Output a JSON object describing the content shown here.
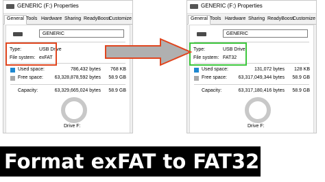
{
  "left_window": {
    "title": "GENERIC (F:) Properties",
    "tabs": [
      "General",
      "Tools",
      "Hardware",
      "Sharing",
      "ReadyBoost",
      "Customize"
    ],
    "volume_name": "GENERIC",
    "type_label": "Type:",
    "type_value": "USB Drive",
    "fs_label": "File system:",
    "fs_value": "exFAT",
    "used_label": "Used space:",
    "used_bytes": "786,432 bytes",
    "used_size": "768 KB",
    "free_label": "Free space:",
    "free_bytes": "63,328,878,592 bytes",
    "free_size": "58.9 GB",
    "capacity_label": "Capacity:",
    "capacity_bytes": "63,329,665,024 bytes",
    "capacity_size": "58.9 GB",
    "drive_label": "Drive F:",
    "highlight_color": "#e0451e"
  },
  "right_window": {
    "title": "GENERIC (F:) Properties",
    "tabs": [
      "General",
      "Tools",
      "Hardware",
      "Sharing",
      "ReadyBoost",
      "Customize"
    ],
    "volume_name": "GENERIC",
    "type_label": "Type:",
    "type_value": "USB Drive",
    "fs_label": "File system:",
    "fs_value": "FAT32",
    "used_label": "Used space:",
    "used_bytes": "131,072 bytes",
    "used_size": "128 KB",
    "free_label": "Free space:",
    "free_bytes": "63,317,049,344 bytes",
    "free_size": "58.9 GB",
    "capacity_label": "Capacity:",
    "capacity_bytes": "63,317,180,416 bytes",
    "capacity_size": "58.9 GB",
    "drive_label": "Drive F:",
    "highlight_color": "#3cc63c"
  },
  "banner": {
    "text": "Format exFAT to FAT32"
  },
  "colors": {
    "used": "#1e88d0",
    "free": "#a8a8a8",
    "arrow_fill": "#b0b0b0",
    "arrow_stroke": "#e0451e"
  }
}
